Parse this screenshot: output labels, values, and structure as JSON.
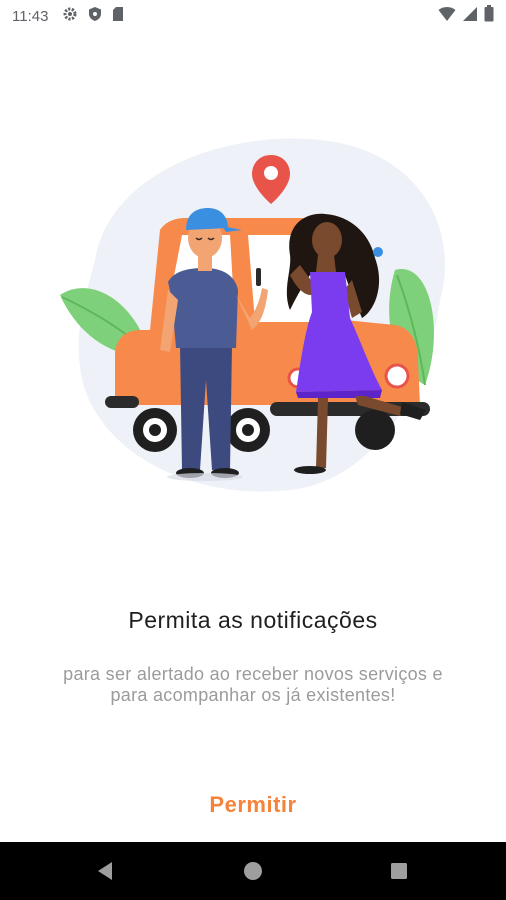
{
  "status_bar": {
    "time": "11:43",
    "left_icons": [
      "gear-icon",
      "shield-icon",
      "sd-card-icon"
    ],
    "right_icons": [
      "wifi-icon",
      "signal-icon",
      "battery-icon"
    ]
  },
  "illustration": {
    "description_icon": "car-couple-illustration",
    "colors": {
      "car": "#f78a4b",
      "blob": "#eef1f7",
      "pin": "#e8534a",
      "leaf": "#7fd07a",
      "dress": "#7b3cf0",
      "shirt": "#4b5b94",
      "cap": "#3b8fe0"
    }
  },
  "content": {
    "title": "Permita as notificações",
    "subtitle": "para ser alertado ao receber novos serviços e para acompanhar os já existentes!",
    "allow_label": "Permitir"
  },
  "nav_bar": {
    "icons": [
      "back-icon",
      "home-icon",
      "recents-icon"
    ]
  },
  "theme": {
    "accent": "#f5833a",
    "title_color": "#1f1f1f",
    "subtitle_color": "#9b9b9b"
  }
}
